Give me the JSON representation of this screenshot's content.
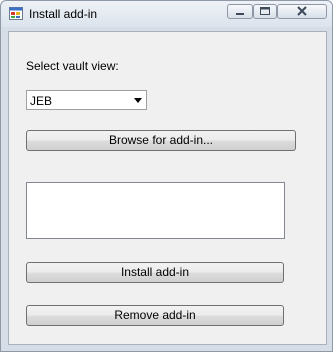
{
  "window": {
    "title": "Install add-in",
    "icon": "app-window-icon"
  },
  "titlebar_buttons": {
    "minimize_icon": "minimize-icon",
    "maximize_icon": "maximize-icon",
    "close_icon": "close-icon"
  },
  "form": {
    "vault_label": "Select vault view:",
    "vault_selected": "JEB",
    "browse_label": "Browse for add-in...",
    "addin_list": [],
    "install_label": "Install add-in",
    "remove_label": "Remove add-in"
  },
  "colors": {
    "close_accent": "#c75050",
    "client_background": "#f0f0f0"
  }
}
